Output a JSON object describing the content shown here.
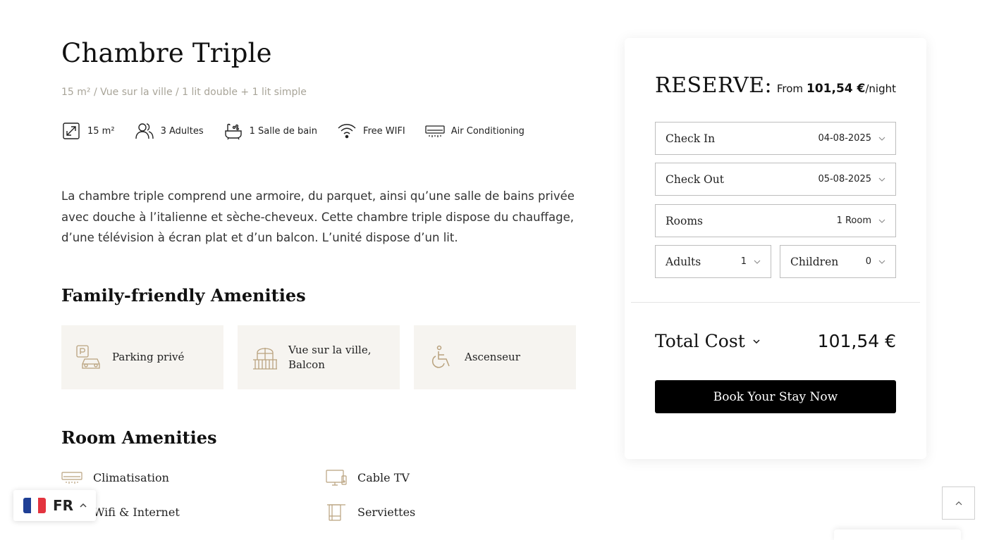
{
  "room": {
    "title": "Chambre Triple",
    "subtitle": "15 m² / Vue sur la ville / 1 lit double + 1 lit simple",
    "features": [
      {
        "icon": "resize-icon",
        "label": "15 m²"
      },
      {
        "icon": "guests-icon",
        "label": "3 Adultes"
      },
      {
        "icon": "bathtub-icon",
        "label": "1 Salle de bain"
      },
      {
        "icon": "wifi-icon",
        "label": "Free WIFI"
      },
      {
        "icon": "air-conditioner-icon",
        "label": "Air Conditioning"
      }
    ],
    "description": "La chambre triple comprend une armoire, du parquet, ainsi qu’une salle de bains privée avec douche à l’italienne et sèche-cheveux. Cette chambre triple dispose du chauffage, d’une télévision à écran plat et d’un balcon. L’unité dispose d’un lit."
  },
  "family_amenities": {
    "title": "Family-friendly Amenities",
    "items": [
      {
        "icon": "parking-icon",
        "label": "Parking privé"
      },
      {
        "icon": "balcony-icon",
        "label": "Vue sur la ville, Balcon"
      },
      {
        "icon": "accessibility-icon",
        "label": "Ascenseur"
      }
    ]
  },
  "room_amenities": {
    "title": "Room Amenities",
    "items": [
      {
        "icon": "air-conditioner-icon",
        "label": "Climatisation"
      },
      {
        "icon": "tv-icon",
        "label": "Cable TV"
      },
      {
        "icon": "wifi-icon",
        "label": "Wifi & Internet"
      },
      {
        "icon": "towel-icon",
        "label": "Serviettes"
      }
    ]
  },
  "reserve": {
    "title": "RESERVE:",
    "price_prefix": "From",
    "price": "101,54 €",
    "price_suffix": "/night",
    "check_in": {
      "label": "Check In",
      "value": "04-08-2025"
    },
    "check_out": {
      "label": "Check Out",
      "value": "05-08-2025"
    },
    "rooms": {
      "label": "Rooms",
      "value": "1 Room"
    },
    "adults": {
      "label": "Adults",
      "value": "1"
    },
    "children": {
      "label": "Children",
      "value": "0"
    },
    "total_label": "Total Cost",
    "total_value": "101,54 €",
    "book_label": "Book Your Stay Now"
  },
  "language": {
    "code": "FR"
  },
  "colors": {
    "icon_gold": "#b9a27e",
    "card_bg": "#f6f4f0",
    "button_bg": "#000000"
  }
}
